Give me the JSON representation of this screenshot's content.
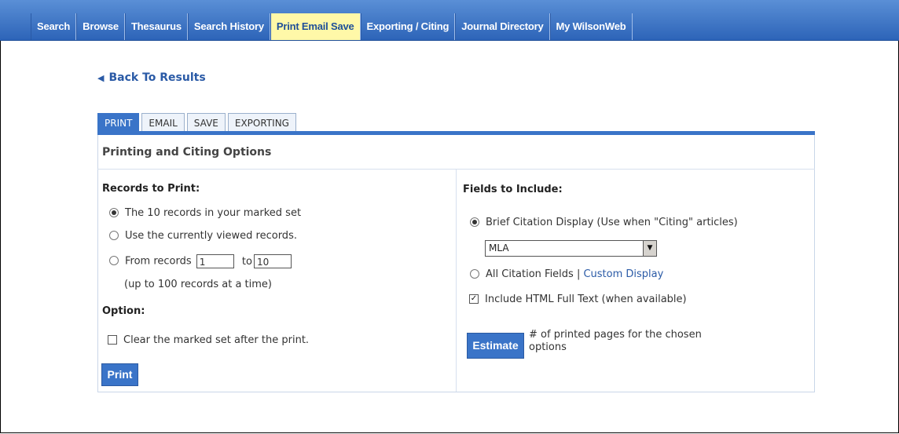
{
  "nav": {
    "tabs": [
      {
        "label": "Search"
      },
      {
        "label": "Browse"
      },
      {
        "label": "Thesaurus"
      },
      {
        "label": "Search History"
      },
      {
        "label": "Print Email Save"
      },
      {
        "label": "Exporting / Citing"
      },
      {
        "label": "Journal Directory"
      },
      {
        "label": "My WilsonWeb"
      }
    ],
    "active_index": 4
  },
  "back_link": "Back To Results",
  "subtabs": [
    "PRINT",
    "EMAIL",
    "SAVE",
    "EXPORTING"
  ],
  "panel_title": "Printing and Citing Options",
  "records": {
    "heading": "Records to Print:",
    "option_marked": "The 10 records in your marked set",
    "option_current": "Use the currently viewed records.",
    "option_range_prefix": "From records",
    "range_from": "1",
    "range_to_label": "to",
    "range_to": "10",
    "range_note": "(up to 100 records at a time)"
  },
  "option": {
    "heading": "Option:",
    "clear_label": "Clear the marked set after the print."
  },
  "print_button": "Print",
  "fields": {
    "heading": "Fields to Include:",
    "brief_label": "Brief Citation Display (Use when \"Citing\" articles)",
    "citation_style": "MLA",
    "all_fields_label": "All Citation Fields |",
    "custom_display": "Custom Display",
    "html_fulltext": "Include HTML Full Text (when available)"
  },
  "estimate": {
    "button": "Estimate",
    "line1": "# of printed pages for the chosen",
    "line2": "options"
  }
}
